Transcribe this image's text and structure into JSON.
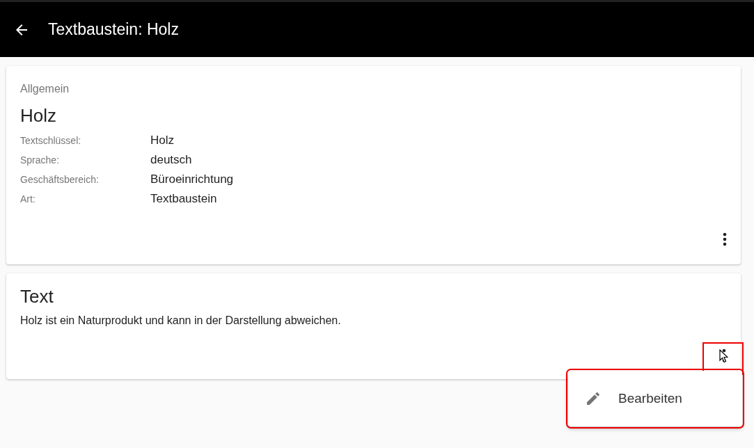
{
  "app_bar": {
    "title": "Textbaustein: Holz"
  },
  "general_card": {
    "overline": "Allgemein",
    "heading": "Holz",
    "fields": [
      {
        "label": "Textschlüssel:",
        "value": "Holz"
      },
      {
        "label": "Sprache:",
        "value": "deutsch"
      },
      {
        "label": "Geschäftsbereich:",
        "value": "Büroeinrichtung"
      },
      {
        "label": "Art:",
        "value": "Textbaustein"
      }
    ]
  },
  "text_card": {
    "heading": "Text",
    "body": "Holz ist ein Naturprodukt und kann in der Darstellung abweichen."
  },
  "context_menu": {
    "open": true,
    "items": [
      {
        "label": "Bearbeiten"
      }
    ]
  }
}
